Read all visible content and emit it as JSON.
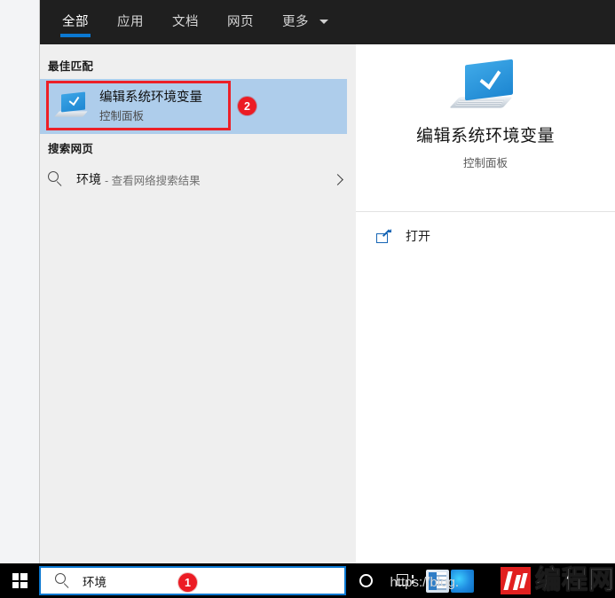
{
  "tabs": [
    {
      "label": "全部",
      "active": true
    },
    {
      "label": "应用",
      "active": false
    },
    {
      "label": "文档",
      "active": false
    },
    {
      "label": "网页",
      "active": false
    },
    {
      "label": "更多",
      "active": false,
      "has_caret": true
    }
  ],
  "results": {
    "best_match_header": "最佳匹配",
    "best_match": {
      "title": "编辑系统环境变量",
      "subtitle": "控制面板",
      "icon": "monitor-check-icon",
      "annotation_badge": "2"
    },
    "web_header": "搜索网页",
    "web_item": {
      "icon": "search-icon",
      "query": "环境",
      "description": "- 查看网络搜索结果",
      "chevron": "chevron-right-icon"
    }
  },
  "preview": {
    "icon": "monitor-check-icon",
    "title": "编辑系统环境变量",
    "subtitle": "控制面板",
    "actions": [
      {
        "label": "打开",
        "icon": "open-external-icon"
      }
    ]
  },
  "taskbar": {
    "start_icon": "windows-logo-icon",
    "search": {
      "icon": "search-icon",
      "value": "环境",
      "annotation_badge": "1"
    },
    "cortana_icon": "cortana-circle-icon",
    "taskview_icon": "task-view-icon",
    "url_text": "https://blog."
  },
  "watermark": {
    "logo": "chengxu-logo-icon",
    "text": "编程网"
  },
  "colors": {
    "accent_blue": "#0a77d0",
    "tabbar_bg": "#1f1f1f",
    "panel_bg": "#efefef",
    "highlight_row": "#aecdeb",
    "annotation_red": "#ec2028",
    "badge_red": "#ec1c24",
    "taskbar_bg": "#000000",
    "watermark_red": "#e1201f"
  }
}
